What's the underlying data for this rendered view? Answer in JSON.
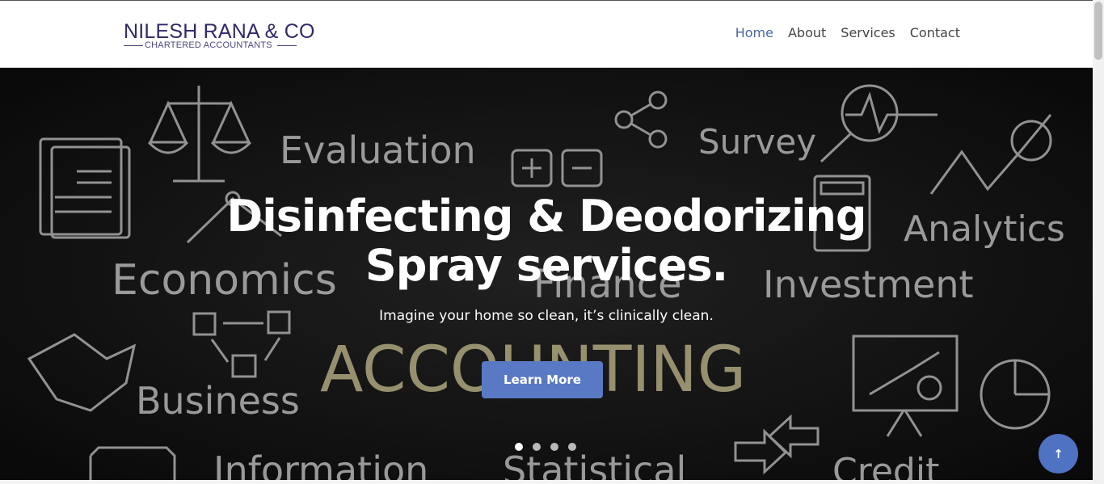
{
  "logo": {
    "title": "NILESH RANA & CO",
    "subtitle": "CHARTERED ACCOUNTANTS"
  },
  "nav": {
    "items": [
      "Home",
      "About",
      "Services",
      "Contact"
    ],
    "active": "Home"
  },
  "hero": {
    "title_line1": "Disinfecting & Deodorizing",
    "title_line2": "Spray services.",
    "subtitle": "Imagine your home so clean, it’s clinically clean.",
    "button_label": "Learn More",
    "background_words": [
      "Evaluation",
      "Survey",
      "Analytics",
      "Economics",
      "Finance",
      "Investment",
      "ACCOUNTING",
      "Business",
      "Information",
      "Statistical",
      "Credit"
    ],
    "slide_count": 4,
    "active_slide": 1
  },
  "colors": {
    "brand": "#2e2a6b",
    "accent": "#5a79c4",
    "nav_active": "#4a67a8"
  },
  "icons": {
    "back_to_top": "arrow-up-icon"
  }
}
